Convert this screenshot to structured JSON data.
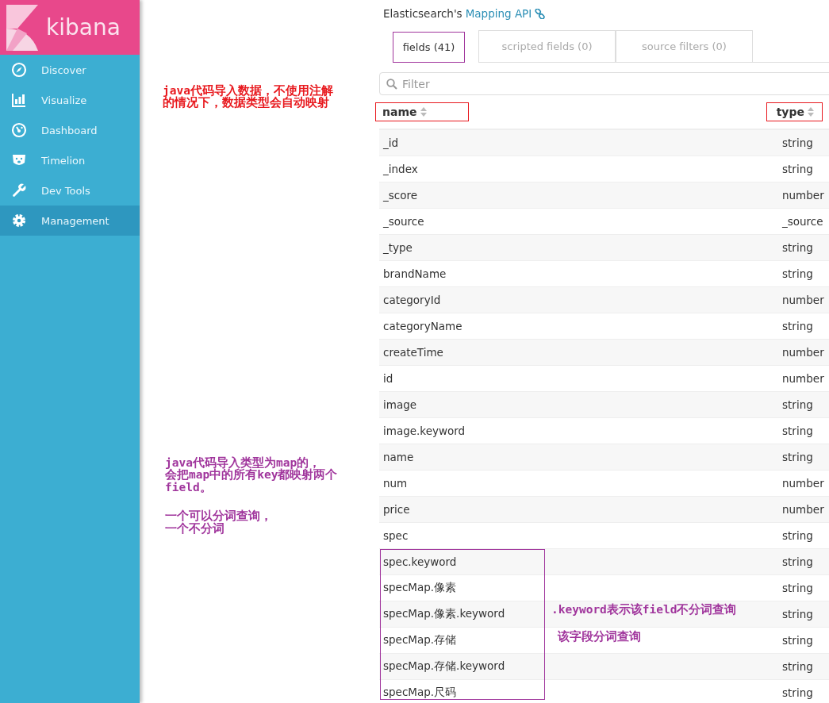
{
  "sidebar": {
    "logo": "kibana",
    "items": [
      {
        "label": "Discover",
        "selected": false
      },
      {
        "label": "Visualize",
        "selected": false
      },
      {
        "label": "Dashboard",
        "selected": false
      },
      {
        "label": "Timelion",
        "selected": false
      },
      {
        "label": "Dev Tools",
        "selected": false
      },
      {
        "label": "Management",
        "selected": true
      }
    ]
  },
  "intro": {
    "line2": "Elasticsearch's",
    "link": "Mapping API"
  },
  "tabs": [
    {
      "label": "fields (41)",
      "selected": true,
      "color": "#a0359c"
    },
    {
      "label": "scripted fields (0)",
      "selected": false
    },
    {
      "label": "source filters (0)",
      "selected": false
    }
  ],
  "filter": {
    "placeholder": "Filter"
  },
  "table": {
    "columns": [
      {
        "label": "name",
        "color": "#e8191e"
      },
      {
        "label": "type",
        "color": "#e8191e"
      }
    ],
    "rows": [
      {
        "name": "_id",
        "type": "string",
        "boxed": false
      },
      {
        "name": "_index",
        "type": "string",
        "boxed": false
      },
      {
        "name": "_score",
        "type": "number",
        "boxed": false
      },
      {
        "name": "_source",
        "type": "_source",
        "boxed": false
      },
      {
        "name": "_type",
        "type": "string",
        "boxed": false
      },
      {
        "name": "brandName",
        "type": "string",
        "boxed": false
      },
      {
        "name": "categoryId",
        "type": "number",
        "boxed": false
      },
      {
        "name": "categoryName",
        "type": "string",
        "boxed": false
      },
      {
        "name": "createTime",
        "type": "number",
        "boxed": false
      },
      {
        "name": "id",
        "type": "number",
        "boxed": false
      },
      {
        "name": "image",
        "type": "string",
        "boxed": false
      },
      {
        "name": "image.keyword",
        "type": "string",
        "boxed": false
      },
      {
        "name": "name",
        "type": "string",
        "boxed": false
      },
      {
        "name": "num",
        "type": "number",
        "boxed": false
      },
      {
        "name": "price",
        "type": "number",
        "boxed": false
      },
      {
        "name": "spec",
        "type": "string",
        "boxed": false
      },
      {
        "name": "spec.keyword",
        "type": "string",
        "boxed": true
      },
      {
        "name": "specMap.像素",
        "type": "string",
        "boxed": true
      },
      {
        "name": "specMap.像素.keyword",
        "type": "string",
        "boxed": true
      },
      {
        "name": "specMap.存储",
        "type": "string",
        "boxed": true
      },
      {
        "name": "specMap.存储.keyword",
        "type": "string",
        "boxed": true
      },
      {
        "name": "specMap.尺码",
        "type": "string",
        "boxed": true
      }
    ]
  },
  "notes": [
    {
      "color": "#e8191e",
      "text": "java代码导入数据，不使用注解"
    },
    {
      "color": "#e8191e",
      "text": "的情况下，数据类型会自动映射"
    },
    {
      "color": "#a0359c",
      "text": "java代码导入类型为map的，"
    },
    {
      "color": "#a0359c",
      "text": "会把map中的所有key都映射两个"
    },
    {
      "color": "#a0359c",
      "text": "field。"
    },
    {
      "color": "#a0359c",
      "text": "一个可以分词查询，"
    },
    {
      "color": "#a0359c",
      "text": "一个不分词"
    },
    {
      "color": "#a0359c",
      "text": ".keyword表示该field不分词查询"
    },
    {
      "color": "#a0359c",
      "text": "该字段分词查询"
    }
  ]
}
